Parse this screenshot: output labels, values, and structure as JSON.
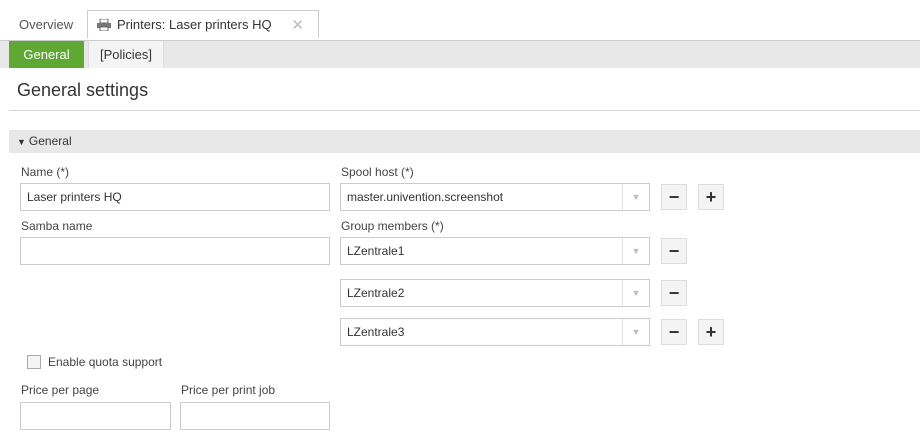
{
  "tabs": {
    "overview": "Overview",
    "active": "Printers: Laser printers HQ",
    "close_icon": "close-icon"
  },
  "subtabs": {
    "general": "General",
    "policies": "[Policies]"
  },
  "page_title": "General settings",
  "section": {
    "title": "General"
  },
  "form": {
    "name_label": "Name (*)",
    "name_value": "Laser printers HQ",
    "samba_label": "Samba name",
    "samba_value": "",
    "spool_label": "Spool host (*)",
    "spool_value": "master.univention.screenshot",
    "group_label": "Group members (*)",
    "group_members": [
      "LZentrale1",
      "LZentrale2",
      "LZentrale3"
    ],
    "quota_label": "Enable quota support",
    "quota_checked": false,
    "price_page_label": "Price per page",
    "price_page_value": "",
    "price_job_label": "Price per print job",
    "price_job_value": ""
  },
  "colors": {
    "accent": "#5fa834"
  }
}
